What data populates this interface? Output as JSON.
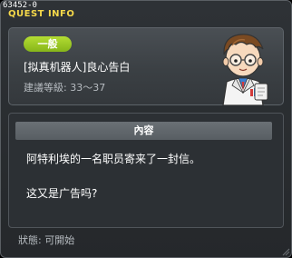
{
  "window": {
    "quest_id": "63452-0",
    "title": "QUEST INFO"
  },
  "quest": {
    "badge": "一般",
    "badge_color": "#9bcc22",
    "name": "[拟真机器人]良心告白",
    "level": "建議等級: 33～37",
    "npc_icon": "scientist-npc-portrait"
  },
  "content": {
    "header": "內容",
    "lines": [
      "阿特利埃的一名职员寄来了一封信。",
      "这又是广告吗?"
    ]
  },
  "status": {
    "text": "狀態:  可開始"
  },
  "colors": {
    "title": "#f6d94a",
    "muted_text": "#b7bcc1"
  }
}
